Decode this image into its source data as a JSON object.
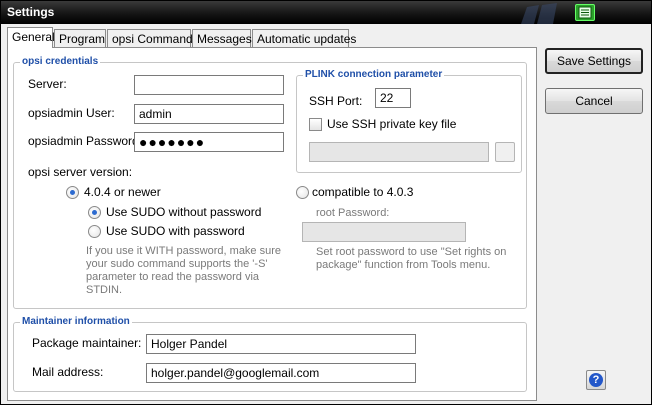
{
  "window": {
    "title": "Settings"
  },
  "tabs": [
    {
      "label": "General",
      "active": true
    },
    {
      "label": "Program",
      "active": false
    },
    {
      "label": "opsi Commands",
      "active": false
    },
    {
      "label": "Messages",
      "active": false
    },
    {
      "label": "Automatic updates",
      "active": false
    }
  ],
  "credentials": {
    "legend": "opsi credentials",
    "server_label": "Server:",
    "server_value": "",
    "user_label": "opsiadmin User:",
    "user_value": "admin",
    "password_label": "opsiadmin Password:",
    "password_value": "●●●●●●●",
    "version_label": "opsi server version:",
    "radio_new_label": "4.0.4 or newer",
    "radio_new_selected": true,
    "sudo_nopass_label": "Use SUDO without password",
    "sudo_nopass_selected": true,
    "sudo_pass_label": "Use SUDO with password",
    "sudo_note": [
      "If you use it WITH password, make sure",
      "your sudo command supports the '-S'",
      "parameter to read the password via",
      "STDIN."
    ],
    "radio_old_label": "compatible to 4.0.3",
    "root_password_label": "root Password:",
    "root_note": [
      "Set root password to use \"Set rights on",
      "package\" function from Tools menu."
    ]
  },
  "plink": {
    "legend": "PLINK connection parameter",
    "ssh_port_label": "SSH Port:",
    "ssh_port_value": "22",
    "private_key_label": "Use SSH private key file",
    "private_key_checked": false,
    "key_file_value": ""
  },
  "maintainer": {
    "legend": "Maintainer information",
    "package_maintainer_label": "Package maintainer:",
    "package_maintainer_value": "Holger Pandel",
    "mail_label": "Mail address:",
    "mail_value": "holger.pandel@googlemail.com"
  },
  "actions": {
    "save_label": "Save Settings",
    "cancel_label": "Cancel",
    "help_label": "?"
  },
  "icons": [
    "app-icon",
    "windows-logo-icon",
    "help-icon"
  ],
  "colors": {
    "legend": "#1f4fa8",
    "radio_selected": "#2d6bd0",
    "app_icon": "#2ca02c"
  }
}
